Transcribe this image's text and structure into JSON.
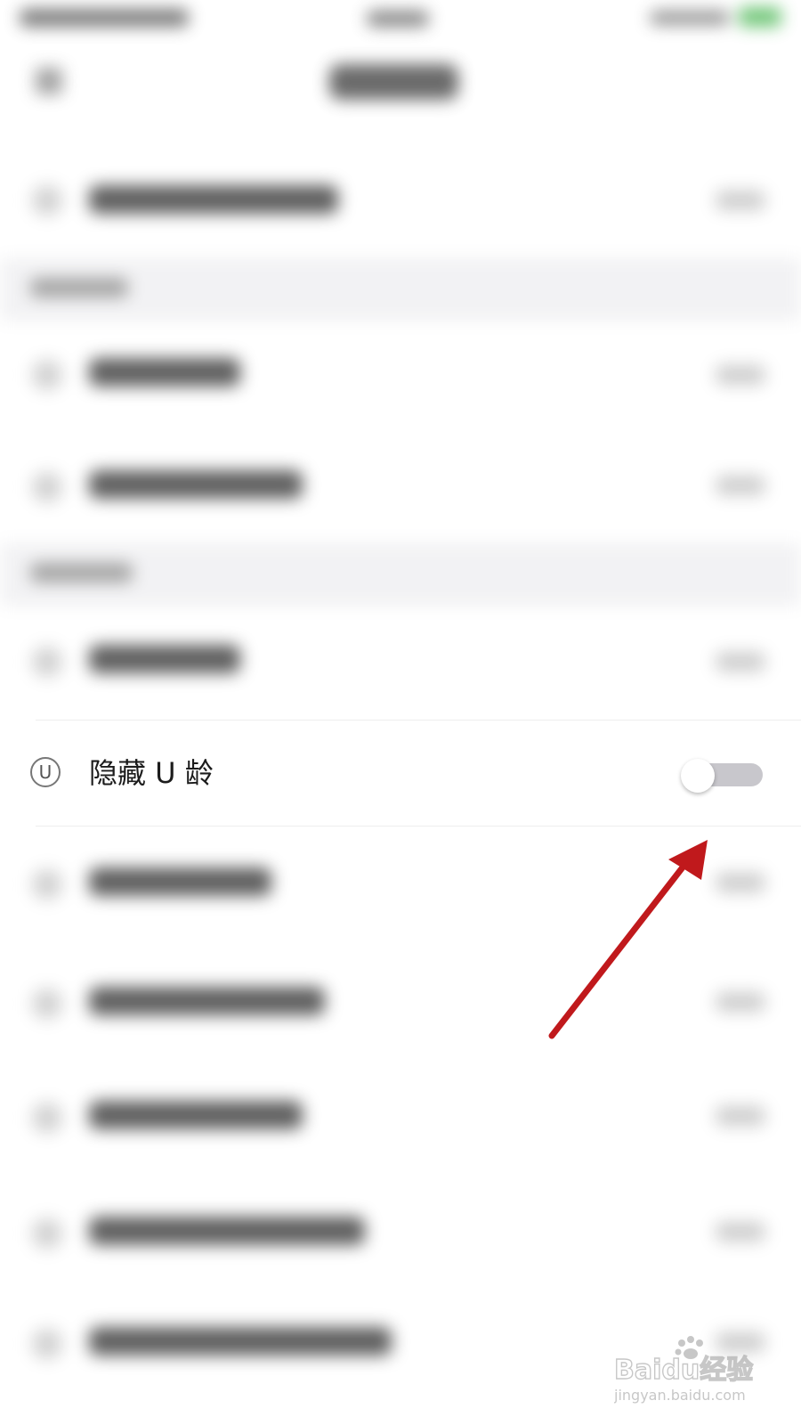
{
  "setting_row": {
    "icon_name": "u-circle-icon",
    "icon_glyph": "U",
    "label": "隐藏 U 龄",
    "toggle_state": "off"
  },
  "watermark": {
    "brand": "Baidu经验",
    "url": "jingyan.baidu.com"
  },
  "colors": {
    "toggle_track_off": "#c8c7cc",
    "annotation_arrow": "#c0191c",
    "section_background": "#f1f1f3"
  }
}
